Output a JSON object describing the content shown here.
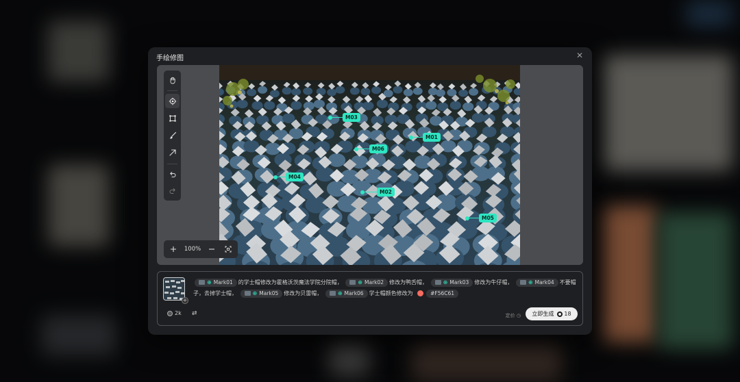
{
  "dialog": {
    "title": "手绘修图",
    "close_symbol": "✕"
  },
  "toolbar": {
    "tools": [
      {
        "name": "hand-tool",
        "icon": "hand-icon"
      },
      {
        "name": "mark-tool",
        "icon": "crosshair-icon",
        "active": true
      },
      {
        "name": "rect-tool",
        "icon": "rect-select-icon"
      },
      {
        "name": "brush-tool",
        "icon": "brush-icon"
      },
      {
        "name": "arrow-tool",
        "icon": "arrow-icon"
      },
      {
        "name": "undo-tool",
        "icon": "undo-icon"
      },
      {
        "name": "redo-tool",
        "icon": "redo-icon"
      }
    ]
  },
  "zoom": {
    "in_symbol": "+",
    "value": "100%",
    "out_symbol": "−",
    "fit_icon": "fit-screen-icon"
  },
  "markers": [
    {
      "id": "M01",
      "label": "M01"
    },
    {
      "id": "M02",
      "label": "M02"
    },
    {
      "id": "M03",
      "label": "M03"
    },
    {
      "id": "M04",
      "label": "M04"
    },
    {
      "id": "M05",
      "label": "M05"
    },
    {
      "id": "M06",
      "label": "M06"
    }
  ],
  "prompt": {
    "parts": {
      "mark01": "Mark01",
      "t1": "的学士帽修改为霍格沃茨魔法学院分院帽，",
      "mark02": "Mark02",
      "t2": "修改为鸭舌帽，",
      "mark03": "Mark03",
      "t3": "修改为牛仔帽，",
      "mark04": "Mark04",
      "t4": "不要帽子，去掉学士帽，",
      "mark05": "Mark05",
      "t5": "修改为贝雷帽，",
      "mark06": "Mark06",
      "t6": "学士帽颜色修改为",
      "color_hex": "#F56C61"
    },
    "color_value": "#F56C61"
  },
  "footer": {
    "quality": "2k",
    "price_label": "定价",
    "generate_label": "立即生成",
    "cost": "18"
  },
  "colors": {
    "accent": "#2ee6c2",
    "selected_color": "#F56C61"
  }
}
